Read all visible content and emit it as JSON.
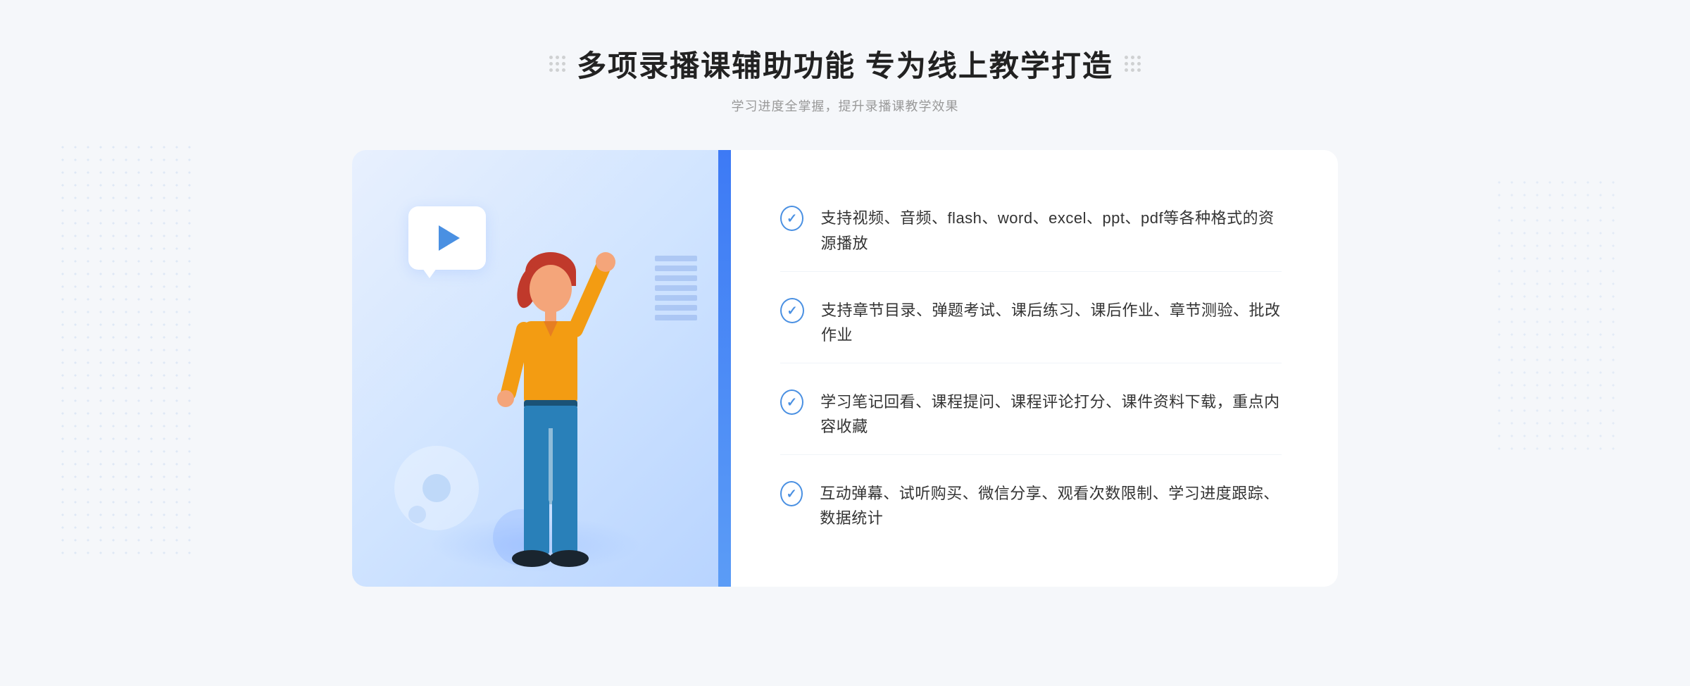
{
  "header": {
    "title": "多项录播课辅助功能 专为线上教学打造",
    "subtitle": "学习进度全掌握，提升录播课教学效果"
  },
  "features": [
    {
      "id": 1,
      "text": "支持视频、音频、flash、word、excel、ppt、pdf等各种格式的资源播放"
    },
    {
      "id": 2,
      "text": "支持章节目录、弹题考试、课后练习、课后作业、章节测验、批改作业"
    },
    {
      "id": 3,
      "text": "学习笔记回看、课程提问、课程评论打分、课件资料下载，重点内容收藏"
    },
    {
      "id": 4,
      "text": "互动弹幕、试听购买、微信分享、观看次数限制、学习进度跟踪、数据统计"
    }
  ],
  "icons": {
    "check": "✓",
    "left_arrow": "»",
    "play": "▶"
  },
  "colors": {
    "primary": "#4a90e2",
    "title": "#222222",
    "subtitle": "#999999",
    "text": "#333333",
    "bg_left": "#dce9ff",
    "separator": "#3d7af5"
  }
}
